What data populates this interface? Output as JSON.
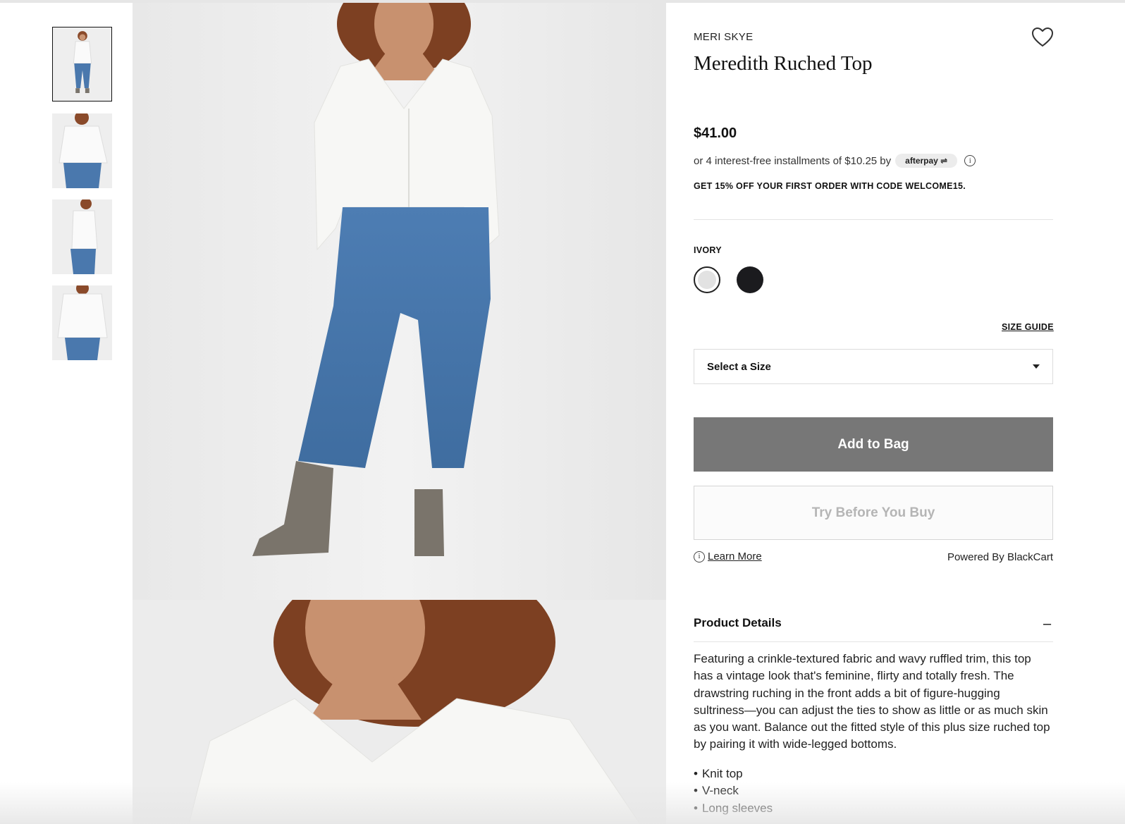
{
  "product": {
    "brand": "MERI SKYE",
    "name": "Meredith Ruched Top",
    "price": "$41.00",
    "installments_text": "or 4 interest-free installments of $10.25 by",
    "afterpay_label": "afterpay",
    "promo": "GET 15% OFF YOUR FIRST ORDER WITH CODE WELCOME15."
  },
  "color": {
    "selected_label": "IVORY",
    "swatches": [
      {
        "name": "ivory",
        "hex": "#e2e2e2",
        "selected": true
      },
      {
        "name": "black",
        "hex": "#1b1b1e",
        "selected": false
      }
    ]
  },
  "size": {
    "guide_label": "SIZE GUIDE",
    "select_placeholder": "Select a Size"
  },
  "actions": {
    "add_to_bag": "Add to Bag",
    "try_before": "Try Before You Buy",
    "learn_more": "Learn More",
    "powered_by": "Powered By BlackCart"
  },
  "details": {
    "title": "Product Details",
    "toggle": "–",
    "description": "Featuring a crinkle-textured fabric and wavy ruffled trim, this top has a vintage look that's feminine, flirty and totally fresh. The drawstring ruching in the front adds a bit of figure-hugging sultriness—you can adjust the ties to show as little or as much skin as you want. Balance out the fitted style of this plus size ruched top by pairing it with wide-legged bottoms.",
    "bullets": [
      "Knit top",
      "V-neck",
      "Long sleeves"
    ]
  },
  "icons": {
    "favorite": "heart-icon",
    "info": "info-icon",
    "dropdown": "caret-down-icon"
  },
  "colors": {
    "add_button_bg": "#777777",
    "text": "#111111"
  }
}
